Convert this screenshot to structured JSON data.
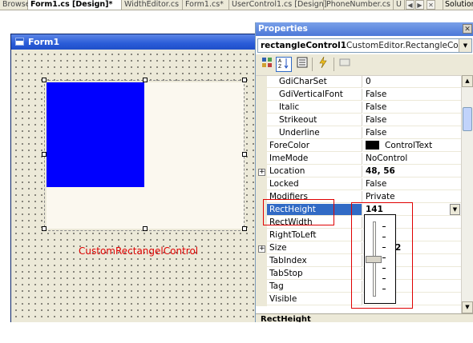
{
  "tabs": [
    {
      "label": "Browser",
      "active": false
    },
    {
      "label": "Form1.cs [Design]*",
      "active": true
    },
    {
      "label": "WidthEditor.cs",
      "active": false
    },
    {
      "label": "Form1.cs*",
      "active": false
    },
    {
      "label": "UserControl1.cs [Design]",
      "active": false
    },
    {
      "label": "PhoneNumber.cs",
      "active": false
    },
    {
      "label": "U",
      "active": false
    }
  ],
  "tab_nav": {
    "left": "◀",
    "right": "▶",
    "close": "✕"
  },
  "solution_tab": "Solution",
  "designer": {
    "form_title": "Form1",
    "control_label": "CustomRectangelControl",
    "colors": {
      "fill": "#0000ff",
      "label": "#e00000",
      "titlebar": "#2a5cd8"
    }
  },
  "properties": {
    "title": "Properties",
    "close": "✕",
    "object_name": "rectangleControl1",
    "object_type": "CustomEditor.RectangleControl",
    "toolbar_icons": [
      "categorized-icon",
      "alphabetical-icon",
      "property-pages-icon",
      "events-icon",
      "blank-icon"
    ],
    "rows": [
      {
        "name": "GdiCharSet",
        "value": "0",
        "sub": true
      },
      {
        "name": "GdiVerticalFont",
        "value": "False",
        "sub": true
      },
      {
        "name": "Italic",
        "value": "False",
        "sub": true
      },
      {
        "name": "Strikeout",
        "value": "False",
        "sub": true
      },
      {
        "name": "Underline",
        "value": "False",
        "sub": true
      },
      {
        "name": "ForeColor",
        "value": "ControlText",
        "swatch": "#000000"
      },
      {
        "name": "ImeMode",
        "value": "NoControl"
      },
      {
        "name": "Location",
        "value": "48, 56",
        "expand": "+",
        "bold": true
      },
      {
        "name": "Locked",
        "value": "False"
      },
      {
        "name": "Modifiers",
        "value": "Private"
      },
      {
        "name": "RectHeight",
        "value": "141",
        "selected": true,
        "bold": true
      },
      {
        "name": "RectWidth",
        "value": ""
      },
      {
        "name": "RightToLeft",
        "value": ""
      },
      {
        "name": "Size",
        "value": "2",
        "expand": "+"
      },
      {
        "name": "TabIndex",
        "value": ""
      },
      {
        "name": "TabStop",
        "value": ""
      },
      {
        "name": "Tag",
        "value": ""
      },
      {
        "name": "Visible",
        "value": ""
      }
    ],
    "description_title": "RectHeight",
    "trackbar_level": 0.5
  }
}
